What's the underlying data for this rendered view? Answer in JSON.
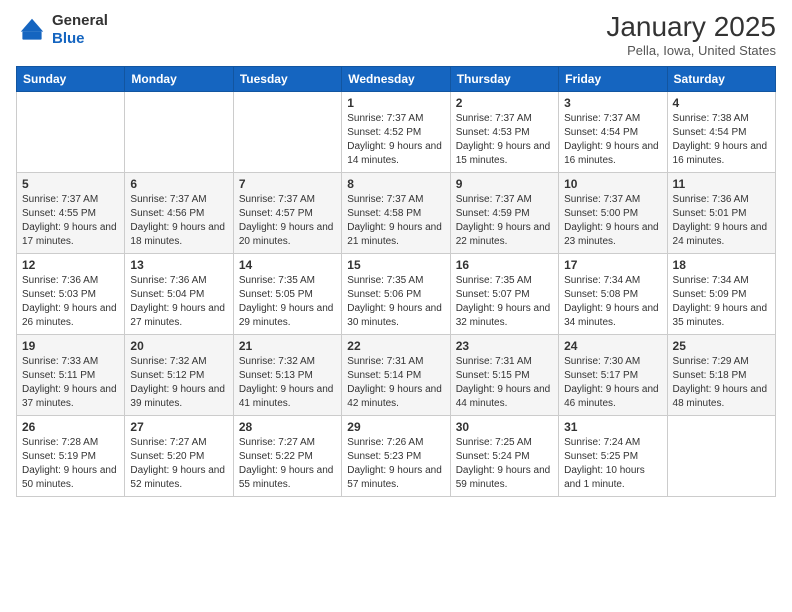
{
  "logo": {
    "general": "General",
    "blue": "Blue"
  },
  "header": {
    "month": "January 2025",
    "location": "Pella, Iowa, United States"
  },
  "weekdays": [
    "Sunday",
    "Monday",
    "Tuesday",
    "Wednesday",
    "Thursday",
    "Friday",
    "Saturday"
  ],
  "weeks": [
    [
      {
        "date": "",
        "sunrise": "",
        "sunset": "",
        "daylight": ""
      },
      {
        "date": "",
        "sunrise": "",
        "sunset": "",
        "daylight": ""
      },
      {
        "date": "",
        "sunrise": "",
        "sunset": "",
        "daylight": ""
      },
      {
        "date": "1",
        "sunrise": "Sunrise: 7:37 AM",
        "sunset": "Sunset: 4:52 PM",
        "daylight": "Daylight: 9 hours and 14 minutes."
      },
      {
        "date": "2",
        "sunrise": "Sunrise: 7:37 AM",
        "sunset": "Sunset: 4:53 PM",
        "daylight": "Daylight: 9 hours and 15 minutes."
      },
      {
        "date": "3",
        "sunrise": "Sunrise: 7:37 AM",
        "sunset": "Sunset: 4:54 PM",
        "daylight": "Daylight: 9 hours and 16 minutes."
      },
      {
        "date": "4",
        "sunrise": "Sunrise: 7:38 AM",
        "sunset": "Sunset: 4:54 PM",
        "daylight": "Daylight: 9 hours and 16 minutes."
      }
    ],
    [
      {
        "date": "5",
        "sunrise": "Sunrise: 7:37 AM",
        "sunset": "Sunset: 4:55 PM",
        "daylight": "Daylight: 9 hours and 17 minutes."
      },
      {
        "date": "6",
        "sunrise": "Sunrise: 7:37 AM",
        "sunset": "Sunset: 4:56 PM",
        "daylight": "Daylight: 9 hours and 18 minutes."
      },
      {
        "date": "7",
        "sunrise": "Sunrise: 7:37 AM",
        "sunset": "Sunset: 4:57 PM",
        "daylight": "Daylight: 9 hours and 20 minutes."
      },
      {
        "date": "8",
        "sunrise": "Sunrise: 7:37 AM",
        "sunset": "Sunset: 4:58 PM",
        "daylight": "Daylight: 9 hours and 21 minutes."
      },
      {
        "date": "9",
        "sunrise": "Sunrise: 7:37 AM",
        "sunset": "Sunset: 4:59 PM",
        "daylight": "Daylight: 9 hours and 22 minutes."
      },
      {
        "date": "10",
        "sunrise": "Sunrise: 7:37 AM",
        "sunset": "Sunset: 5:00 PM",
        "daylight": "Daylight: 9 hours and 23 minutes."
      },
      {
        "date": "11",
        "sunrise": "Sunrise: 7:36 AM",
        "sunset": "Sunset: 5:01 PM",
        "daylight": "Daylight: 9 hours and 24 minutes."
      }
    ],
    [
      {
        "date": "12",
        "sunrise": "Sunrise: 7:36 AM",
        "sunset": "Sunset: 5:03 PM",
        "daylight": "Daylight: 9 hours and 26 minutes."
      },
      {
        "date": "13",
        "sunrise": "Sunrise: 7:36 AM",
        "sunset": "Sunset: 5:04 PM",
        "daylight": "Daylight: 9 hours and 27 minutes."
      },
      {
        "date": "14",
        "sunrise": "Sunrise: 7:35 AM",
        "sunset": "Sunset: 5:05 PM",
        "daylight": "Daylight: 9 hours and 29 minutes."
      },
      {
        "date": "15",
        "sunrise": "Sunrise: 7:35 AM",
        "sunset": "Sunset: 5:06 PM",
        "daylight": "Daylight: 9 hours and 30 minutes."
      },
      {
        "date": "16",
        "sunrise": "Sunrise: 7:35 AM",
        "sunset": "Sunset: 5:07 PM",
        "daylight": "Daylight: 9 hours and 32 minutes."
      },
      {
        "date": "17",
        "sunrise": "Sunrise: 7:34 AM",
        "sunset": "Sunset: 5:08 PM",
        "daylight": "Daylight: 9 hours and 34 minutes."
      },
      {
        "date": "18",
        "sunrise": "Sunrise: 7:34 AM",
        "sunset": "Sunset: 5:09 PM",
        "daylight": "Daylight: 9 hours and 35 minutes."
      }
    ],
    [
      {
        "date": "19",
        "sunrise": "Sunrise: 7:33 AM",
        "sunset": "Sunset: 5:11 PM",
        "daylight": "Daylight: 9 hours and 37 minutes."
      },
      {
        "date": "20",
        "sunrise": "Sunrise: 7:32 AM",
        "sunset": "Sunset: 5:12 PM",
        "daylight": "Daylight: 9 hours and 39 minutes."
      },
      {
        "date": "21",
        "sunrise": "Sunrise: 7:32 AM",
        "sunset": "Sunset: 5:13 PM",
        "daylight": "Daylight: 9 hours and 41 minutes."
      },
      {
        "date": "22",
        "sunrise": "Sunrise: 7:31 AM",
        "sunset": "Sunset: 5:14 PM",
        "daylight": "Daylight: 9 hours and 42 minutes."
      },
      {
        "date": "23",
        "sunrise": "Sunrise: 7:31 AM",
        "sunset": "Sunset: 5:15 PM",
        "daylight": "Daylight: 9 hours and 44 minutes."
      },
      {
        "date": "24",
        "sunrise": "Sunrise: 7:30 AM",
        "sunset": "Sunset: 5:17 PM",
        "daylight": "Daylight: 9 hours and 46 minutes."
      },
      {
        "date": "25",
        "sunrise": "Sunrise: 7:29 AM",
        "sunset": "Sunset: 5:18 PM",
        "daylight": "Daylight: 9 hours and 48 minutes."
      }
    ],
    [
      {
        "date": "26",
        "sunrise": "Sunrise: 7:28 AM",
        "sunset": "Sunset: 5:19 PM",
        "daylight": "Daylight: 9 hours and 50 minutes."
      },
      {
        "date": "27",
        "sunrise": "Sunrise: 7:27 AM",
        "sunset": "Sunset: 5:20 PM",
        "daylight": "Daylight: 9 hours and 52 minutes."
      },
      {
        "date": "28",
        "sunrise": "Sunrise: 7:27 AM",
        "sunset": "Sunset: 5:22 PM",
        "daylight": "Daylight: 9 hours and 55 minutes."
      },
      {
        "date": "29",
        "sunrise": "Sunrise: 7:26 AM",
        "sunset": "Sunset: 5:23 PM",
        "daylight": "Daylight: 9 hours and 57 minutes."
      },
      {
        "date": "30",
        "sunrise": "Sunrise: 7:25 AM",
        "sunset": "Sunset: 5:24 PM",
        "daylight": "Daylight: 9 hours and 59 minutes."
      },
      {
        "date": "31",
        "sunrise": "Sunrise: 7:24 AM",
        "sunset": "Sunset: 5:25 PM",
        "daylight": "Daylight: 10 hours and 1 minute."
      },
      {
        "date": "",
        "sunrise": "",
        "sunset": "",
        "daylight": ""
      }
    ]
  ]
}
